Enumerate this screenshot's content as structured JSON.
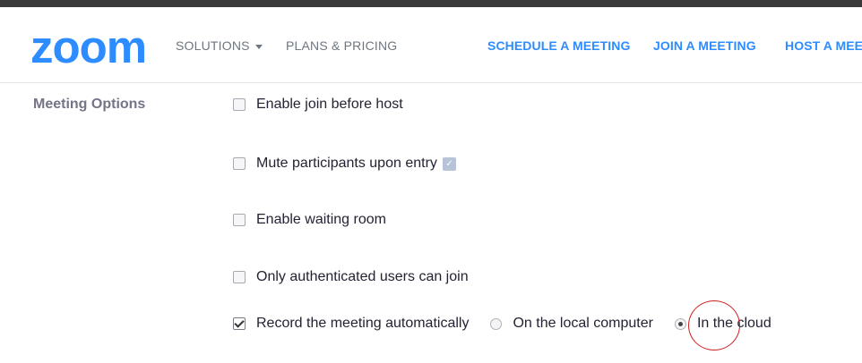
{
  "header": {
    "logo": "zoom",
    "nav_left": [
      {
        "label": "SOLUTIONS",
        "has_dropdown": true
      },
      {
        "label": "PLANS & PRICING",
        "has_dropdown": false
      }
    ],
    "nav_right": [
      {
        "label": "SCHEDULE A MEETING"
      },
      {
        "label": "JOIN A MEETING"
      },
      {
        "label": "HOST A MEE"
      }
    ]
  },
  "section": {
    "label": "Meeting Options",
    "options": [
      {
        "label": "Enable join before host",
        "checked": false
      },
      {
        "label": "Mute participants upon entry",
        "checked": false,
        "info_icon": "info-icon"
      },
      {
        "label": "Enable waiting room",
        "checked": false
      },
      {
        "label": "Only authenticated users can join",
        "checked": false
      },
      {
        "label": "Record the meeting automatically",
        "checked": true
      }
    ],
    "record_location": [
      {
        "label": "On the local computer",
        "selected": false
      },
      {
        "label": "In the cloud",
        "selected": true
      }
    ]
  },
  "colors": {
    "brand": "#2d8cff",
    "annotation": "#d01f1f"
  }
}
